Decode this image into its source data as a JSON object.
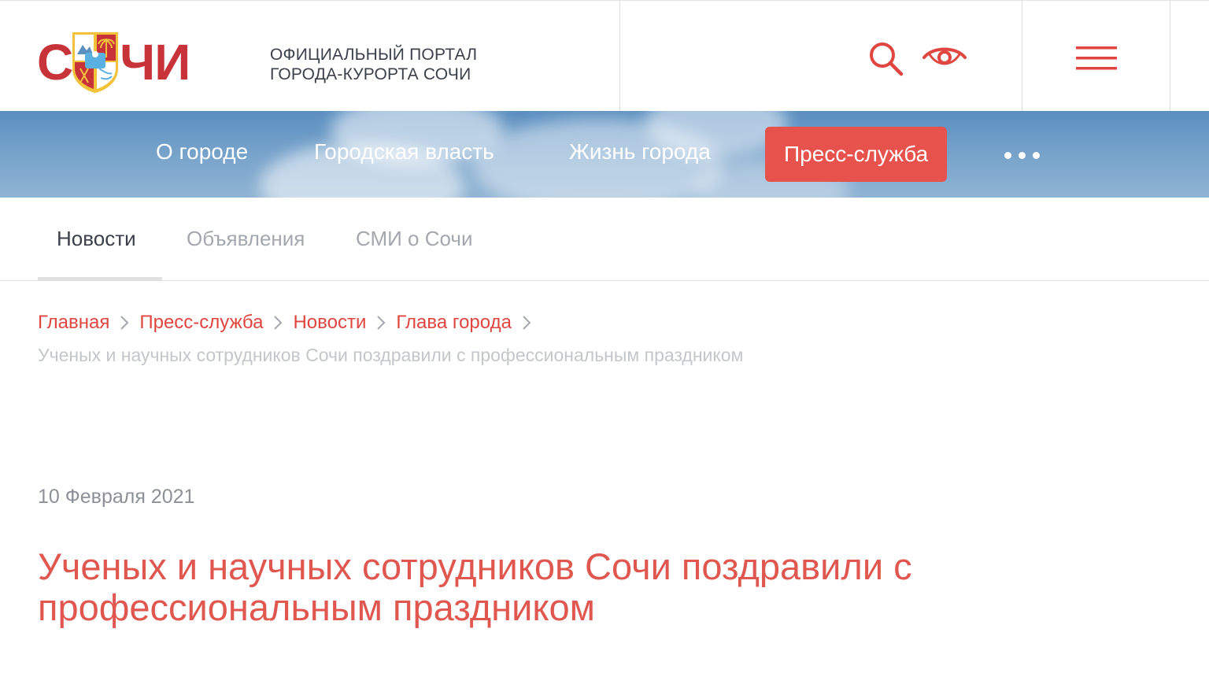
{
  "header": {
    "logo_left": "С",
    "logo_right": "ЧИ",
    "portal_title_line1": "Официальный портал",
    "portal_title_line2": "города-курорта Сочи",
    "icons": [
      "search-icon",
      "eye-icon",
      "hamburger-menu-icon"
    ]
  },
  "nav": {
    "items": [
      {
        "label": "О городе"
      },
      {
        "label": "Городская власть"
      },
      {
        "label": "Жизнь города"
      },
      {
        "label": "Пресс-служба",
        "active": true
      }
    ],
    "more_icon": "more-dots-icon"
  },
  "tabs": [
    {
      "label": "Новости",
      "active": true
    },
    {
      "label": "Объявления"
    },
    {
      "label": "СМИ о Сочи"
    }
  ],
  "breadcrumb": {
    "items": [
      "Главная",
      "Пресс-служба",
      "Новости",
      "Глава города"
    ],
    "current": "Ученых и научных сотрудников Сочи поздравили с профессиональным праздником"
  },
  "article": {
    "date": "10 Февраля 2021",
    "title": "Ученых и научных сотрудников Сочи поздравили с профессиональным праздником"
  },
  "colors": {
    "accent": "#e0463f",
    "logo_red": "#c8333a",
    "nav_active_bg": "#e8524d"
  }
}
